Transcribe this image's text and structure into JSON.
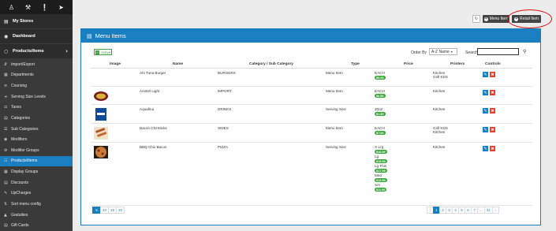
{
  "sidebar": {
    "top_icons": [
      "user-icon",
      "wrench-icon",
      "info-icon",
      "signout-icon"
    ],
    "main": [
      {
        "label": "My Stores",
        "icon": "store-icon"
      },
      {
        "label": "Dashboard",
        "icon": "dashboard-icon"
      },
      {
        "label": "Products/Items",
        "icon": "products-icon"
      }
    ],
    "items": [
      {
        "label": "Import/Export"
      },
      {
        "label": "Departments"
      },
      {
        "label": "Coursing"
      },
      {
        "label": "Serving Size Levels"
      },
      {
        "label": "Taxes"
      },
      {
        "label": "Categories"
      },
      {
        "label": "Sub Categories"
      },
      {
        "label": "Modifiers"
      },
      {
        "label": "Modifier Groups"
      },
      {
        "label": "Products/Items"
      },
      {
        "label": "Display Groups"
      },
      {
        "label": "Discounts"
      },
      {
        "label": "UpCharges"
      },
      {
        "label": "Sort menu config"
      },
      {
        "label": "Gratuities"
      },
      {
        "label": "Gift Cards"
      }
    ]
  },
  "topbar": {
    "menu_item_label": "Menu Item",
    "retail_item_label": "Retail Item",
    "highlight_color": "#dd1111"
  },
  "panel": {
    "title": "Menu Items",
    "active_label": "Active",
    "order_by_label": "Order By",
    "order_by_value": "A-Z Name",
    "search_label": "Search"
  },
  "table": {
    "headers": [
      "Image",
      "Name",
      "Category / Sub Category",
      "Type",
      "Price",
      "Printers",
      "Controls"
    ],
    "rows": [
      {
        "name": "Ahi Tuna Burger",
        "category": "BURGERS",
        "type": "Menu Item",
        "prices": [
          {
            "size": "EACH",
            "value": "$9.95"
          }
        ],
        "printers": [
          "Kitchen",
          "Grill KDS"
        ],
        "image": "none"
      },
      {
        "name": "Amstel Light",
        "category": "IMPORT",
        "type": "Menu Item",
        "prices": [
          {
            "size": "EACH",
            "value": "$6.50"
          }
        ],
        "printers": [
          "Kitchen"
        ],
        "image": "amstel"
      },
      {
        "name": "Aquafina",
        "category": "DRINKS",
        "type": "Serving Size",
        "prices": [
          {
            "size": "20oz",
            "value": "$1.50"
          }
        ],
        "printers": [
          "Kitchen"
        ],
        "image": "aquafina"
      },
      {
        "name": "Bacon ChzSticks",
        "category": "SIDES",
        "type": "Menu Item",
        "prices": [
          {
            "size": "EACH",
            "value": "$7.00"
          }
        ],
        "printers": [
          "Grill KDS",
          "Kitchen"
        ],
        "image": "sticks"
      },
      {
        "name": "BBQ Chix Bacon",
        "category": "PIZZA",
        "type": "Serving Size",
        "prices": [
          {
            "size": "X-Lrg",
            "value": "$18.99"
          },
          {
            "size": "Lg",
            "value": "$15.99"
          },
          {
            "size": "Lg Thin",
            "value": "$17.99"
          },
          {
            "size": "Med",
            "value": "$13.99"
          },
          {
            "size": "Sm",
            "value": "$11.99"
          }
        ],
        "printers": [
          "Kitchen"
        ],
        "image": "pizza"
      }
    ]
  },
  "pagination": {
    "page_sizes": [
      "5",
      "10",
      "15",
      "20"
    ],
    "active_size": "5",
    "pages": [
      "‹",
      "1",
      "2",
      "3",
      "4",
      "5",
      "6",
      "7",
      "...",
      "31",
      "›"
    ],
    "active_page": "1"
  }
}
